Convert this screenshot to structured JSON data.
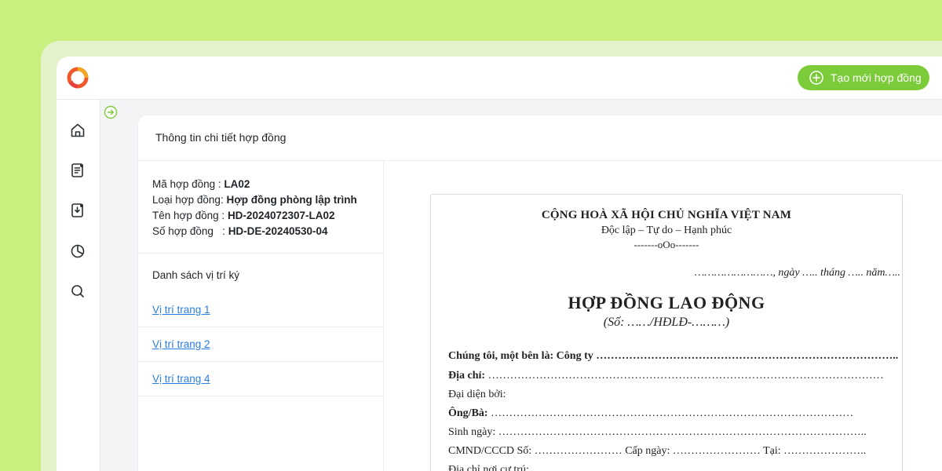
{
  "header": {
    "create_button_label": "Tạo mới hợp đồng"
  },
  "nav": {
    "items": [
      {
        "name": "home-icon"
      },
      {
        "name": "document-icon"
      },
      {
        "name": "download-document-icon"
      },
      {
        "name": "pie-chart-icon"
      },
      {
        "name": "search-icon"
      }
    ]
  },
  "content": {
    "title": "Thông tin chi tiết hợp đồng",
    "info": [
      {
        "label": "Mã hợp đồng",
        "sep": " : ",
        "value": "LA02"
      },
      {
        "label": "Loại hợp đồng",
        "sep": ": ",
        "value": "Hợp đồng phòng lập trình"
      },
      {
        "label": "Tên hợp đồng",
        "sep": " : ",
        "value": "HD-2024072307-LA02"
      },
      {
        "label": "Số hợp đồng",
        "sep": "   : ",
        "value": "HD-DE-20240530-04"
      }
    ],
    "signature_list_title": "Danh sách vị trí ký",
    "signature_positions": [
      "Vị trí trang 1",
      "Vị trí trang 2",
      "Vị trí trang 4"
    ]
  },
  "document": {
    "national_title": "CỘNG HOÀ XÃ HỘI CHỦ NGHĨA VIỆT NAM",
    "motto": "Độc lập – Tự do – Hạnh phúc",
    "separator": "-------oOo-------",
    "date_line": "……………………, ngày ….. tháng ….. năm…..",
    "title": "HỢP ĐỒNG LAO ĐỘNG",
    "number": "(Số: ……/HĐLĐ-………)",
    "lines": {
      "party": "Chúng tôi, một bên là: Công ty ………………………………………………………………………..",
      "address_label": "Địa chỉ:",
      "address_dots": " ………………………………………………………………………………………………",
      "representative": "Đại diện bởi:",
      "mr_mrs_label": "Ông/Bà:",
      "mr_mrs_dots": " ………………………………………………………………………………………",
      "birth": "Sinh ngày: ………………………………………………………………………………………..",
      "id": "CMND/CCCD Số: …………………… Cấp ngày: …………………… Tại: …………………..",
      "residence": "Địa chỉ nơi cư trú: ………………………………………………………………………………"
    }
  },
  "colors": {
    "background": "#c9f07e",
    "accent": "#7ccc3a",
    "link": "#2a7de1"
  }
}
